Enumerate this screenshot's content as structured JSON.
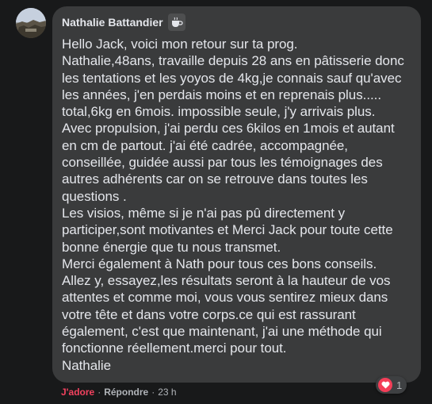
{
  "comment": {
    "author": "Nathalie Battandier",
    "badge_icon": "coffee-cup-icon",
    "text": "Hello Jack, voici mon retour sur ta prog.\nNathalie,48ans, travaille depuis 28 ans en pâtisserie donc les tentations et les yoyos de 4kg,je connais sauf qu'avec les années, j'en perdais moins et en reprenais plus.....\ntotal,6kg en 6mois. impossible seule, j'y arrivais plus.\nAvec propulsion, j'ai perdu ces 6kilos en 1mois et autant en cm de partout. j'ai été cadrée, accompagnée, conseillée, guidée aussi par tous les témoignages des autres adhérents car on se retrouve dans toutes les questions .\nLes visios, même si je n'ai pas pû directement y participer,sont motivantes et Merci Jack pour toute cette bonne énergie que tu nous transmet.\nMerci également à Nath pour tous ces bons conseils.\nAllez y, essayez,les résultats seront à la hauteur de vos attentes et comme moi, vous vous sentirez mieux dans votre tête et dans votre corps.ce qui est rassurant également, c'est que maintenant, j'ai une méthode qui fonctionne réellement.merci pour tout.\nNathalie"
  },
  "actions": {
    "adore_label": "J'adore",
    "separator": "·",
    "reply_label": "Répondre",
    "time": "23 h"
  },
  "reactions": {
    "icon": "heart-icon",
    "count": "1"
  },
  "colors": {
    "background": "#18191a",
    "bubble": "#3a3b3c",
    "text": "#e4e6eb",
    "secondary_text": "#b0b3b8",
    "adore": "#f3425f",
    "heart": "#f33e58"
  }
}
